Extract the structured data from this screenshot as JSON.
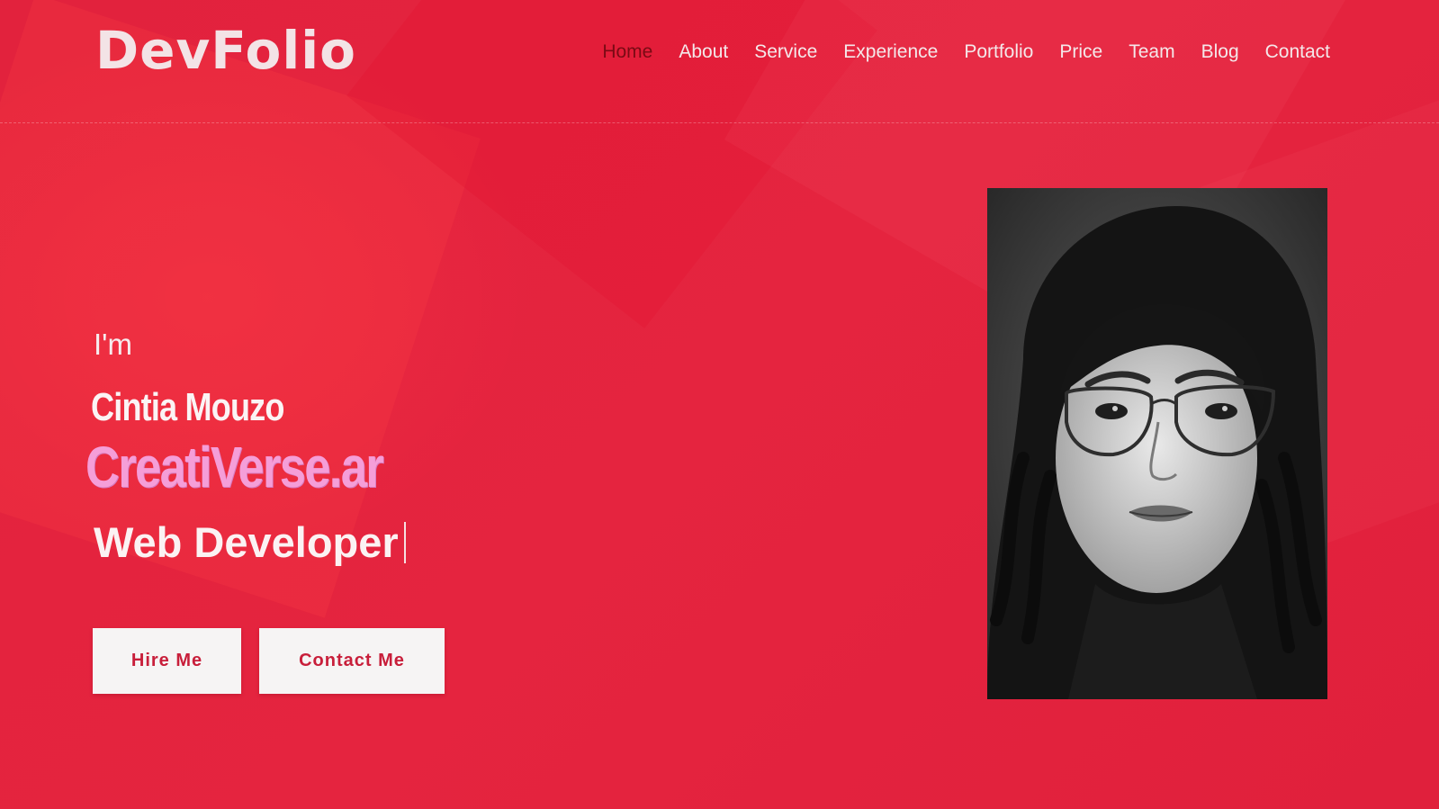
{
  "header": {
    "logo": "DevFolio",
    "nav": [
      {
        "label": "Home",
        "active": true
      },
      {
        "label": "About",
        "active": false
      },
      {
        "label": "Service",
        "active": false
      },
      {
        "label": "Experience",
        "active": false
      },
      {
        "label": "Portfolio",
        "active": false
      },
      {
        "label": "Price",
        "active": false
      },
      {
        "label": "Team",
        "active": false
      },
      {
        "label": "Blog",
        "active": false
      },
      {
        "label": "Contact",
        "active": false
      }
    ]
  },
  "hero": {
    "intro": "I'm",
    "name": "Cintia Mouzo",
    "brand": "CreatiVerse.ar",
    "role": "Web Developer",
    "buttons": {
      "hire": "Hire Me",
      "contact": "Contact Me"
    }
  },
  "colors": {
    "background": "#e4233f",
    "nav_active": "#7a0a14",
    "brand_text": "#f59ed8",
    "button_text": "#c81e3a",
    "button_bg": "#f6f4f4"
  }
}
